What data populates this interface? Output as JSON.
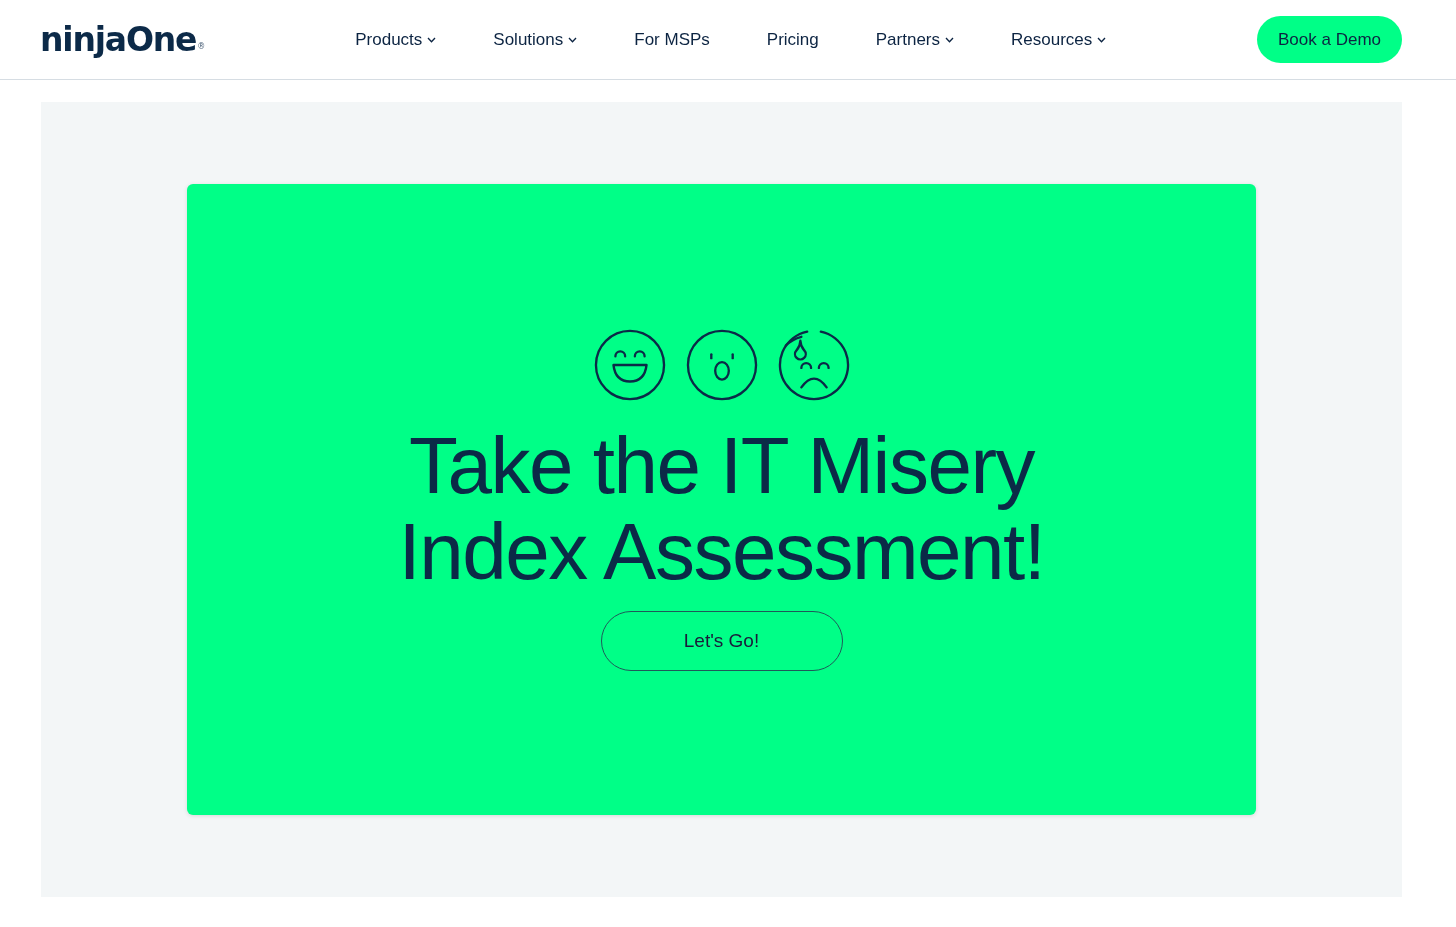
{
  "header": {
    "logo": {
      "name": "ninjaOne",
      "mark": "®"
    },
    "nav": [
      {
        "label": "Products",
        "dropdown": true
      },
      {
        "label": "Solutions",
        "dropdown": true
      },
      {
        "label": "For MSPs",
        "dropdown": false
      },
      {
        "label": "Pricing",
        "dropdown": false
      },
      {
        "label": "Partners",
        "dropdown": true
      },
      {
        "label": "Resources",
        "dropdown": true
      }
    ],
    "cta": {
      "label": "Book a Demo"
    }
  },
  "promo": {
    "faces": [
      {
        "kind": "laughing"
      },
      {
        "kind": "surprised"
      },
      {
        "kind": "sweating"
      }
    ],
    "title_lines": [
      "Take the IT Misery",
      "Index Assessment!"
    ],
    "button": {
      "label": "Let's Go!"
    }
  }
}
